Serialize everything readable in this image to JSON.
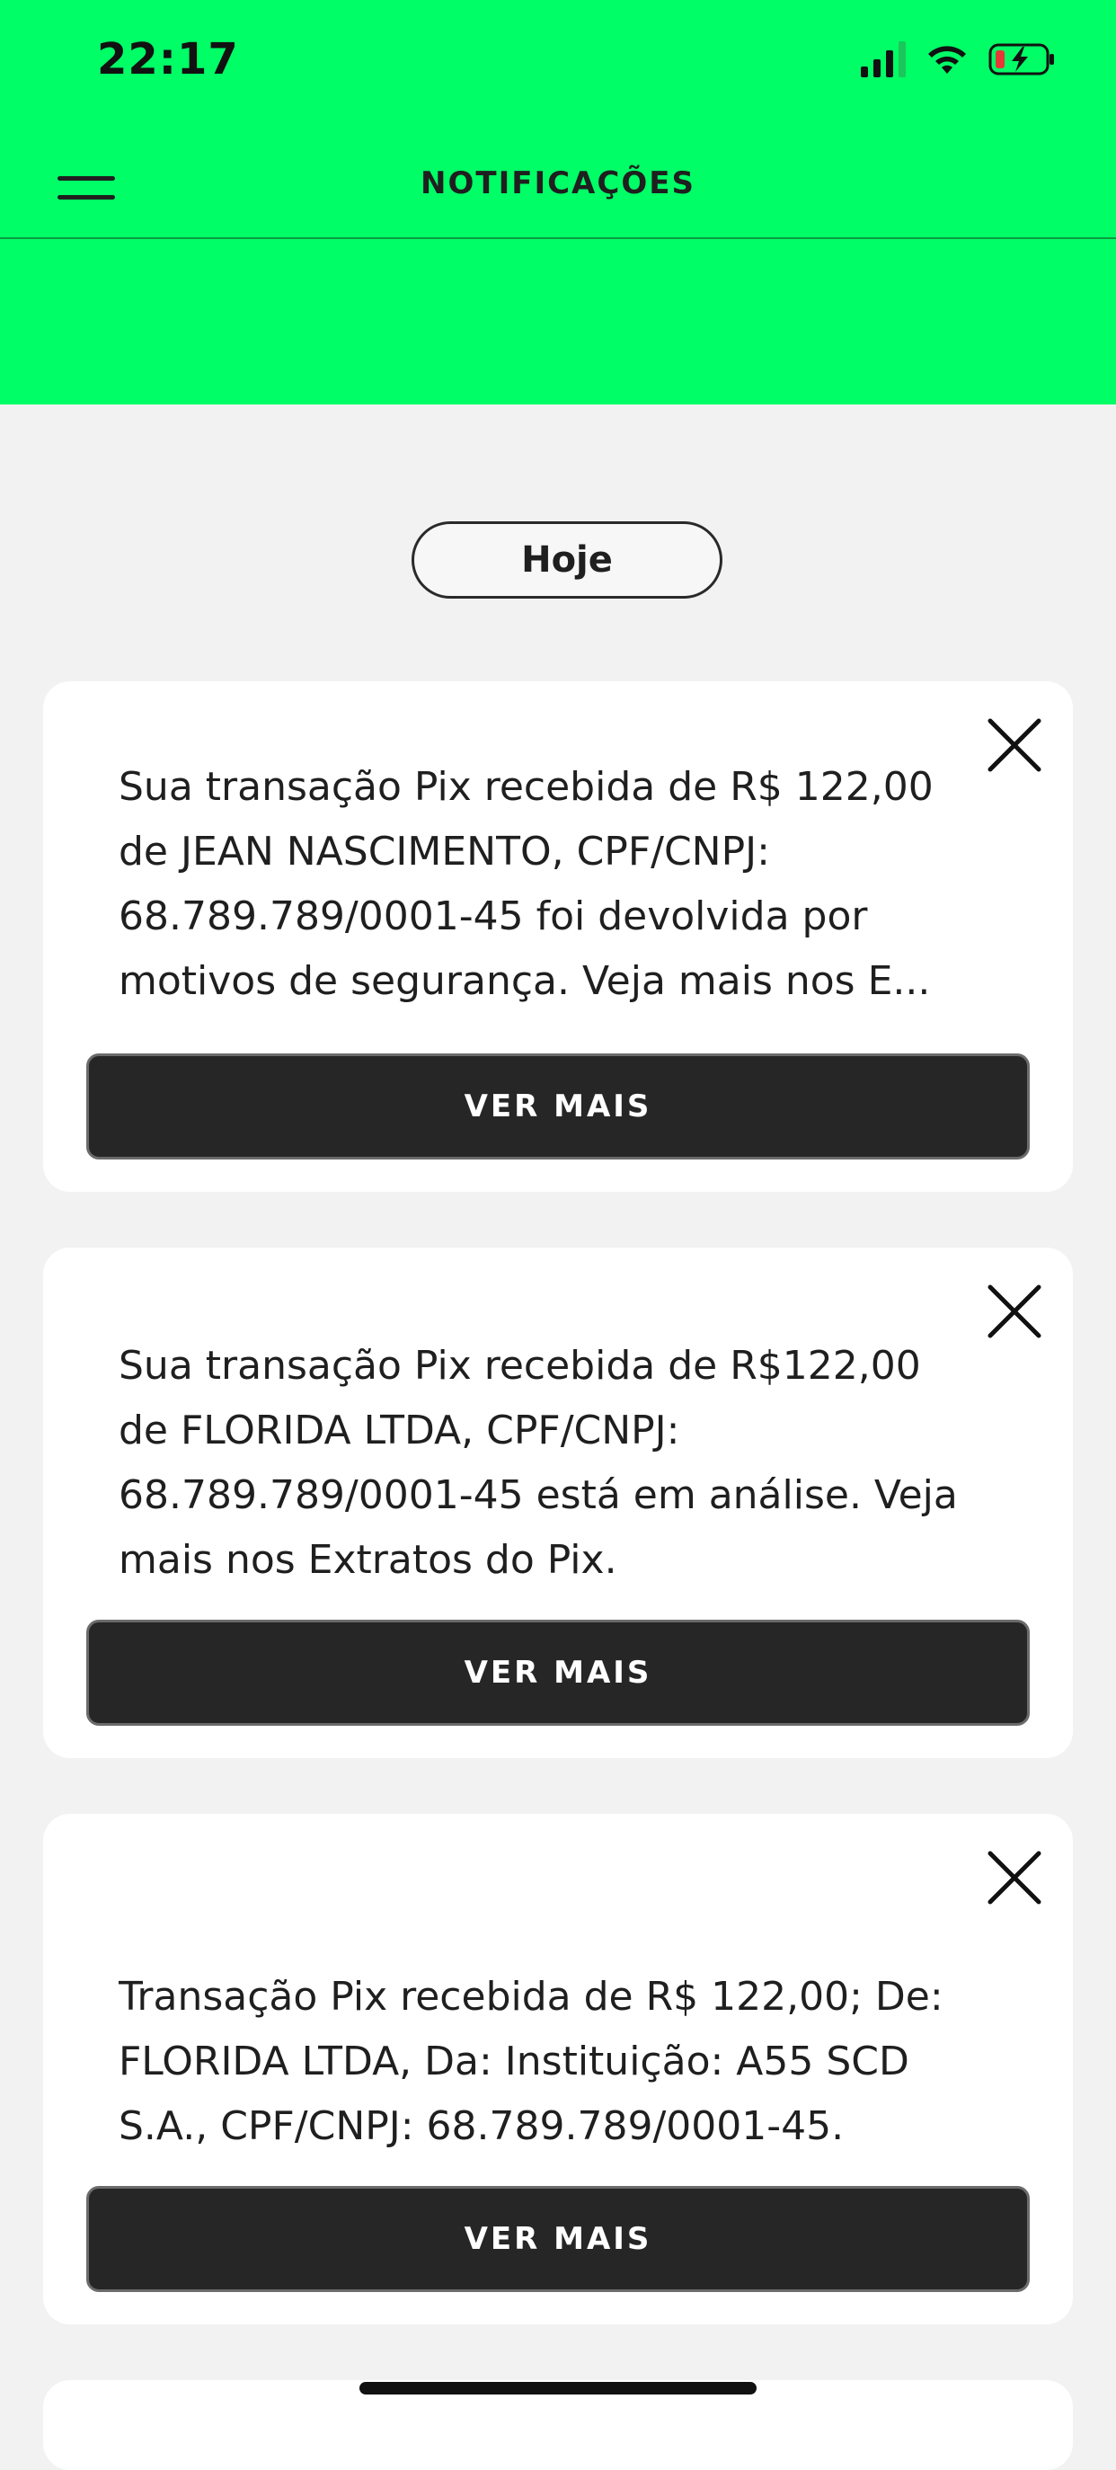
{
  "status_bar": {
    "time": "22:17",
    "icons": [
      "cellular-signal-icon",
      "wifi-icon",
      "battery-charging-icon"
    ]
  },
  "header": {
    "title": "NOTIFICAÇÕES",
    "menu_icon": "hamburger-menu-icon",
    "background_color": "#00ff66"
  },
  "date_group": {
    "label": "Hoje"
  },
  "notifications": [
    {
      "message": "Sua transação Pix recebida de R$ 122,00 de JEAN NASCIMENTO, CPF/CNPJ: 68.789.789/0001-45  foi devolvida por motivos de segurança. Veja mais nos E...",
      "button_label": "VER MAIS"
    },
    {
      "message": "Sua transação Pix recebida de R$122,00 de FLORIDA LTDA, CPF/CNPJ: 68.789.789/0001-45 está em análise. Veja mais nos Extratos do Pix.",
      "button_label": "VER MAIS"
    },
    {
      "message": "Transação Pix recebida de R$ 122,00; De: FLORIDA LTDA, Da: Instituição: A55 SCD S.A., CPF/CNPJ: 68.789.789/0001-45.",
      "button_label": "VER MAIS"
    }
  ],
  "colors": {
    "accent": "#00ff66",
    "button_bg": "#262626",
    "page_bg": "#f2f2f2"
  }
}
